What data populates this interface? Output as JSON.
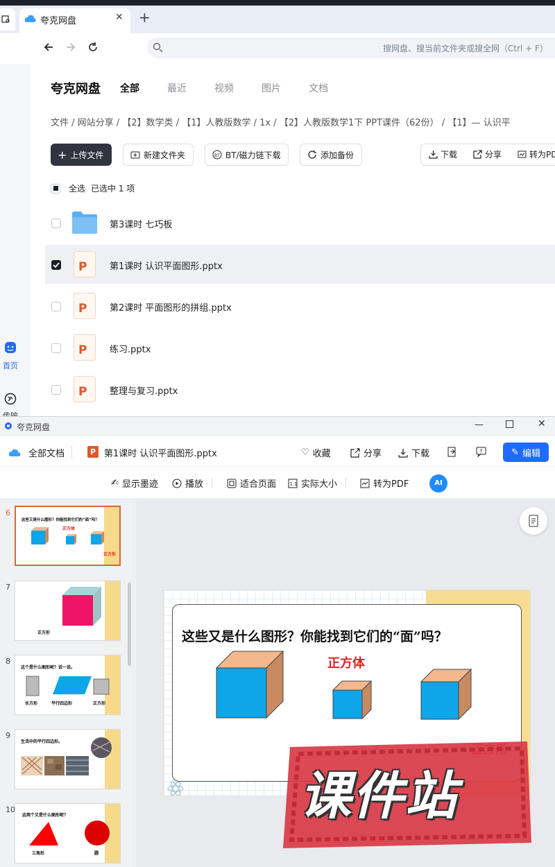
{
  "browser": {
    "tab_title": "夸克网盘",
    "search_placeholder": "搜网盘、搜当前文件夹或搜全网（Ctrl + F）"
  },
  "rail": {
    "home_label": "首页",
    "transfer_label": "传输"
  },
  "header": {
    "brand": "夸克网盘",
    "tabs": [
      "全部",
      "最近",
      "视频",
      "图片",
      "文档"
    ]
  },
  "breadcrumb": "文件 / 网站分享 / 【2】数学类 / 【1】人教版数学 / 1x / 【2】人教版数学1下 PPT课件（62份） / 【1】— 认识平",
  "actions": {
    "upload": "上传文件",
    "new_folder": "新建文件夹",
    "bt": "BT/磁力链下载",
    "backup": "添加备份",
    "download": "下载",
    "share": "分享",
    "to_pdf": "转为PDF"
  },
  "selection": {
    "select_all": "全选",
    "selected_text": "已选中 1 项"
  },
  "files": [
    {
      "name": "第3课时 七巧板",
      "type": "folder",
      "checked": false
    },
    {
      "name": "第1课时 认识平面图形.pptx",
      "type": "pptx",
      "checked": true
    },
    {
      "name": "第2课时 平面图形的拼组.pptx",
      "type": "pptx",
      "checked": false
    },
    {
      "name": "练习.pptx",
      "type": "pptx",
      "checked": false
    },
    {
      "name": "整理与复习.pptx",
      "type": "pptx",
      "checked": false
    }
  ],
  "viewer": {
    "window_title": "夸克网盘",
    "all_docs": "全部文档",
    "file_name": "第1课时 认识平面图形.pptx",
    "favorite": "收藏",
    "share": "分享",
    "download": "下载",
    "edit": "编辑",
    "show_ink": "显示墨迹",
    "play": "播放",
    "fit_page": "适合页面",
    "actual_size": "实际大小",
    "to_pdf": "转为PDF",
    "ai": "AI"
  },
  "thumbnails": [
    {
      "num": "6",
      "text": "这些又是什么图形？你能找到它们的“面”吗？",
      "sub": "正方体",
      "sub2": "正方形"
    },
    {
      "num": "7",
      "text": "正方形"
    },
    {
      "num": "8",
      "text": "这个是什么图形呢？说一说。",
      "labels": [
        "长方形",
        "平行四边形",
        "正方形"
      ]
    },
    {
      "num": "9",
      "text": "生活中的平行四边形。"
    },
    {
      "num": "10",
      "text": "这两个又是什么图形呢？",
      "labels": [
        "三角形",
        "圆"
      ]
    }
  ],
  "slide": {
    "title": "这些又是什么图形？你能找到它们的“面”吗？",
    "label": "正方体",
    "partial_label": "正方形",
    "watermark": "课件站"
  },
  "colors": {
    "accent": "#1f6bff",
    "dark_button": "#31343f",
    "cube_front": "#0ea5e9",
    "cube_top": "#f4b88c",
    "cube_side": "#c98a62"
  }
}
